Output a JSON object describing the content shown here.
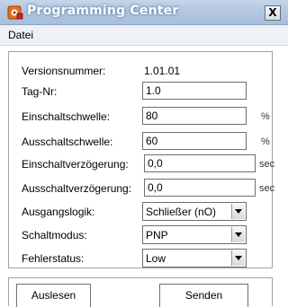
{
  "window": {
    "title": "Programming Center",
    "app_icon": "programming-center-icon",
    "close_label": "X",
    "accent_color": "#b3c7df"
  },
  "menu": {
    "items": [
      {
        "label": "Datei"
      }
    ]
  },
  "form": {
    "version": {
      "label": "Versionsnummer:",
      "value": "1.01.01"
    },
    "tag": {
      "label": "Tag-Nr:",
      "value": "1.0"
    },
    "switch_on_threshold": {
      "label": "Einschaltschwelle:",
      "value": "80",
      "unit": "%"
    },
    "switch_off_threshold": {
      "label": "Ausschaltschwelle:",
      "value": "60",
      "unit": "%"
    },
    "switch_on_delay": {
      "label": "Einschaltverzögerung:",
      "value": "0,0",
      "unit": "sec"
    },
    "switch_off_delay": {
      "label": "Ausschaltverzögerung:",
      "value": "0,0",
      "unit": "sec"
    },
    "output_logic": {
      "label": "Ausgangslogik:",
      "selected": "Schließer (nO)"
    },
    "switch_mode": {
      "label": "Schaltmodus:",
      "selected": "PNP"
    },
    "error_status": {
      "label": "Fehlerstatus:",
      "selected": "Low"
    }
  },
  "actions": {
    "read_label": "Auslesen",
    "send_label": "Senden"
  }
}
